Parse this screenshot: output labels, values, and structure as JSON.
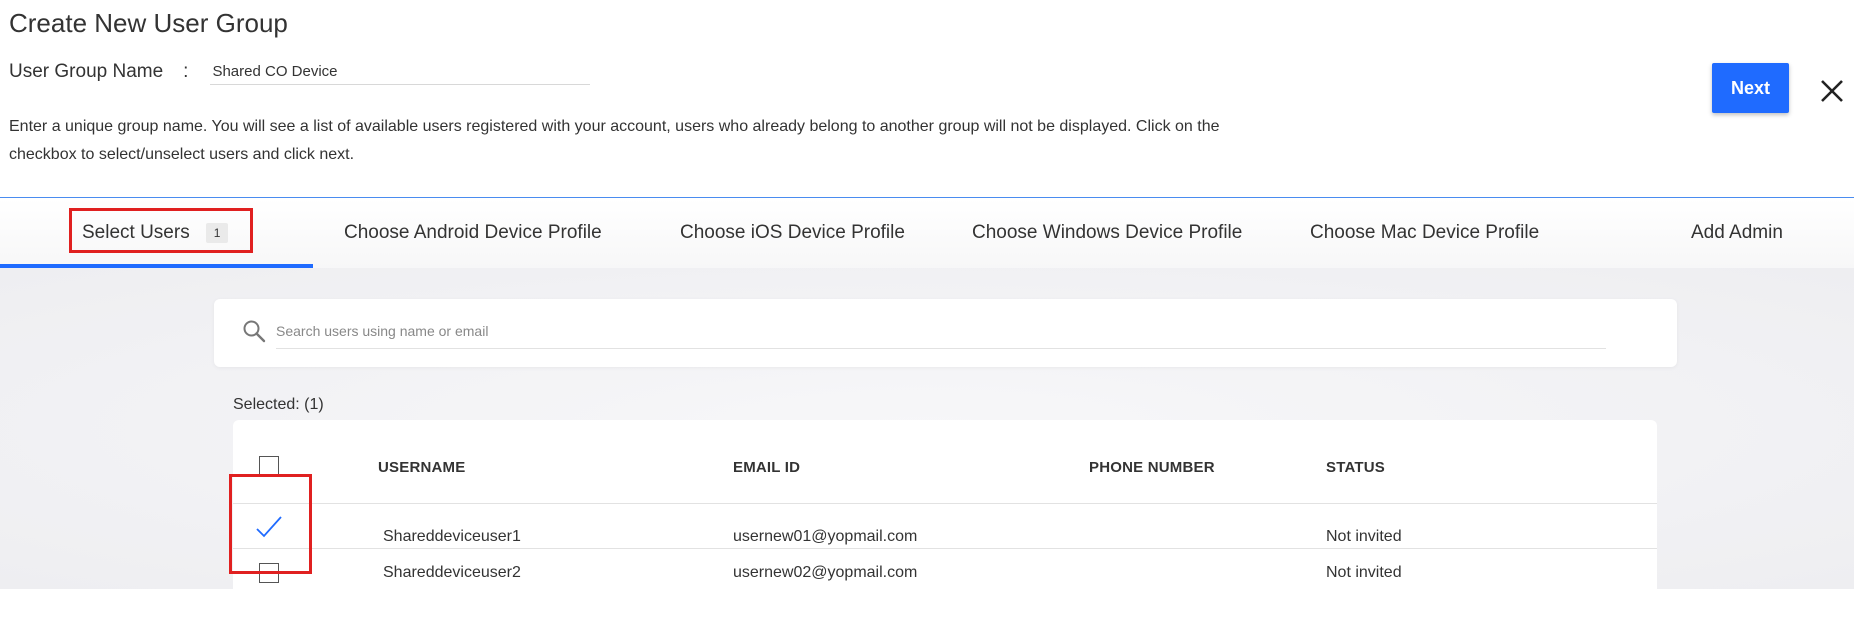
{
  "page": {
    "title": "Create New User Group"
  },
  "group_name": {
    "label": "User Group Name",
    "separator": ":",
    "value": "Shared CO Device"
  },
  "description": "Enter a unique group name. You will see a list of available users registered with your account, users who already belong to another group will not be displayed. Click on the checkbox to select/unselect users and click next.",
  "actions": {
    "next_label": "Next",
    "close_icon": "close-icon"
  },
  "tabs": [
    {
      "label": "Select Users",
      "count": "1",
      "active": true
    },
    {
      "label": "Choose Android Device Profile"
    },
    {
      "label": "Choose iOS Device Profile"
    },
    {
      "label": "Choose Windows Device Profile"
    },
    {
      "label": "Choose Mac Device Profile"
    },
    {
      "label": "Add Admin"
    }
  ],
  "search": {
    "placeholder": "Search users using name or email",
    "icon": "search-icon"
  },
  "selected_label": "Selected: (1)",
  "table": {
    "columns": [
      "USERNAME",
      "EMAIL ID",
      "PHONE NUMBER",
      "STATUS"
    ],
    "rows": [
      {
        "selected": true,
        "username": "Shareddeviceuser1",
        "email": "usernew01@yopmail.com",
        "phone": "",
        "status": "Not invited"
      },
      {
        "selected": false,
        "username": "Shareddeviceuser2",
        "email": "usernew02@yopmail.com",
        "phone": "",
        "status": "Not invited"
      }
    ]
  },
  "colors": {
    "accent": "#1f6bff",
    "highlight": "#e02020"
  }
}
